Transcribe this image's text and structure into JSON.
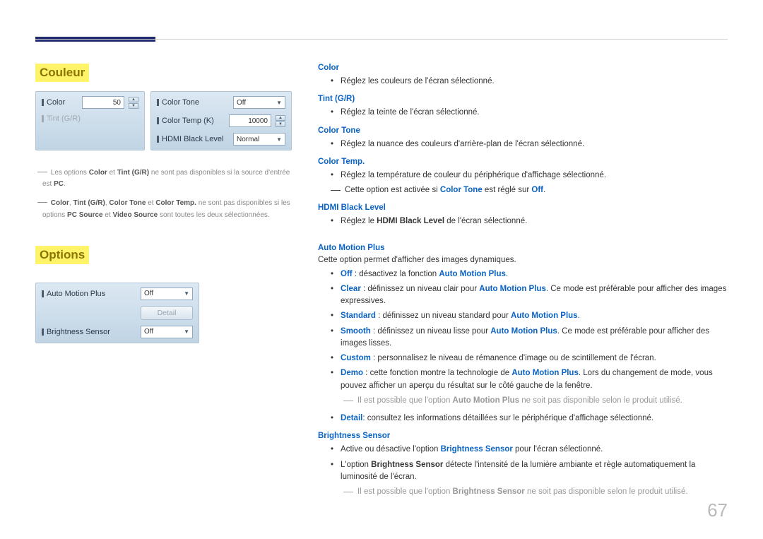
{
  "page_number": "67",
  "left": {
    "couleur": {
      "heading": "Couleur",
      "panel1": {
        "color": {
          "label": "Color",
          "value": "50"
        },
        "tint": {
          "label": "Tint (G/R)"
        }
      },
      "panel2": {
        "color_tone": {
          "label": "Color Tone",
          "value": "Off"
        },
        "color_temp": {
          "label": "Color Temp (K)",
          "value": "10000"
        },
        "hdmi_black": {
          "label": "HDMI Black Level",
          "value": "Normal"
        }
      },
      "footnote1": {
        "prefix": "Les options ",
        "b1": "Color",
        "mid1": " et ",
        "b2": "Tint (G/R)",
        "mid2": " ne sont pas disponibles si la source d'entrée est ",
        "b3": "PC",
        "suffix": "."
      },
      "footnote2": {
        "b1": "Color",
        "s1": ", ",
        "b2": "Tint (G/R)",
        "s2": ", ",
        "b3": "Color Tone",
        "s3": " et ",
        "b4": "Color Temp.",
        "s4": " ne sont pas disponibles si les options ",
        "b5": "PC Source",
        "s5": " et ",
        "b6": "Video Source",
        "s6": " sont toutes les deux sélectionnées."
      }
    },
    "options": {
      "heading": "Options",
      "auto_motion": {
        "label": "Auto Motion Plus",
        "value": "Off"
      },
      "detail_btn": "Detail",
      "brightness_sensor": {
        "label": "Brightness Sensor",
        "value": "Off"
      }
    }
  },
  "right": {
    "color": {
      "term": "Color",
      "text": "Réglez les couleurs de l'écran sélectionné."
    },
    "tint": {
      "term": "Tint (G/R)",
      "text": "Réglez la teinte de l'écran sélectionné."
    },
    "color_tone": {
      "term": "Color Tone",
      "text": "Réglez la nuance des couleurs d'arrière-plan de l'écran sélectionné."
    },
    "color_temp": {
      "term": "Color Temp.",
      "text": "Réglez la température de couleur du périphérique d'affichage sélectionné.",
      "note_pre": "Cette option est activée si ",
      "note_b1": "Color Tone",
      "note_mid": " est réglé sur ",
      "note_b2": "Off",
      "note_suf": "."
    },
    "hdmi": {
      "term": "HDMI Black Level",
      "pre": "Réglez le ",
      "b": "HDMI Black Level",
      "suf": " de l'écran sélectionné."
    },
    "auto_motion": {
      "term": "Auto Motion Plus",
      "intro": "Cette option permet d'afficher des images dynamiques.",
      "off": {
        "b": "Off",
        "mid": " : désactivez la fonction ",
        "b2": "Auto Motion Plus",
        "suf": "."
      },
      "clear": {
        "b": "Clear",
        "mid": " : définissez un niveau clair pour ",
        "b2": "Auto Motion Plus",
        "suf": ". Ce mode est préférable pour afficher des images expressives."
      },
      "standard": {
        "b": "Standard",
        "mid": " : définissez un niveau standard pour ",
        "b2": "Auto Motion Plus",
        "suf": "."
      },
      "smooth": {
        "b": "Smooth",
        "mid": " : définissez un niveau lisse pour ",
        "b2": "Auto Motion Plus",
        "suf": ". Ce mode est préférable pour afficher des images lisses."
      },
      "custom": {
        "b": "Custom",
        "suf": " : personnalisez le niveau de rémanence d'image ou de scintillement de l'écran."
      },
      "demo": {
        "b": "Demo",
        "mid": " : cette fonction montre la technologie de ",
        "b2": "Auto Motion Plus",
        "suf": ". Lors du changement de mode, vous pouvez afficher un aperçu du résultat sur le côté gauche de la fenêtre."
      },
      "note1_pre": "Il est possible que l'option ",
      "note1_b": "Auto Motion Plus",
      "note1_suf": " ne soit pas disponible selon le produit utilisé.",
      "detail": {
        "b": "Detail",
        "suf": ": consultez les informations détaillées sur le périphérique d'affichage sélectionné."
      }
    },
    "brightness": {
      "term": "Brightness Sensor",
      "line1_pre": "Active ou désactive l'option ",
      "line1_b": "Brightness Sensor",
      "line1_suf": " pour l'écran sélectionné.",
      "line2_pre": "L'option ",
      "line2_b": "Brightness Sensor",
      "line2_suf": " détecte l'intensité de la lumière ambiante et règle automatiquement la luminosité de l'écran.",
      "note_pre": "Il est possible que l'option ",
      "note_b": "Brightness Sensor",
      "note_suf": " ne soit pas disponible selon le produit utilisé."
    }
  }
}
